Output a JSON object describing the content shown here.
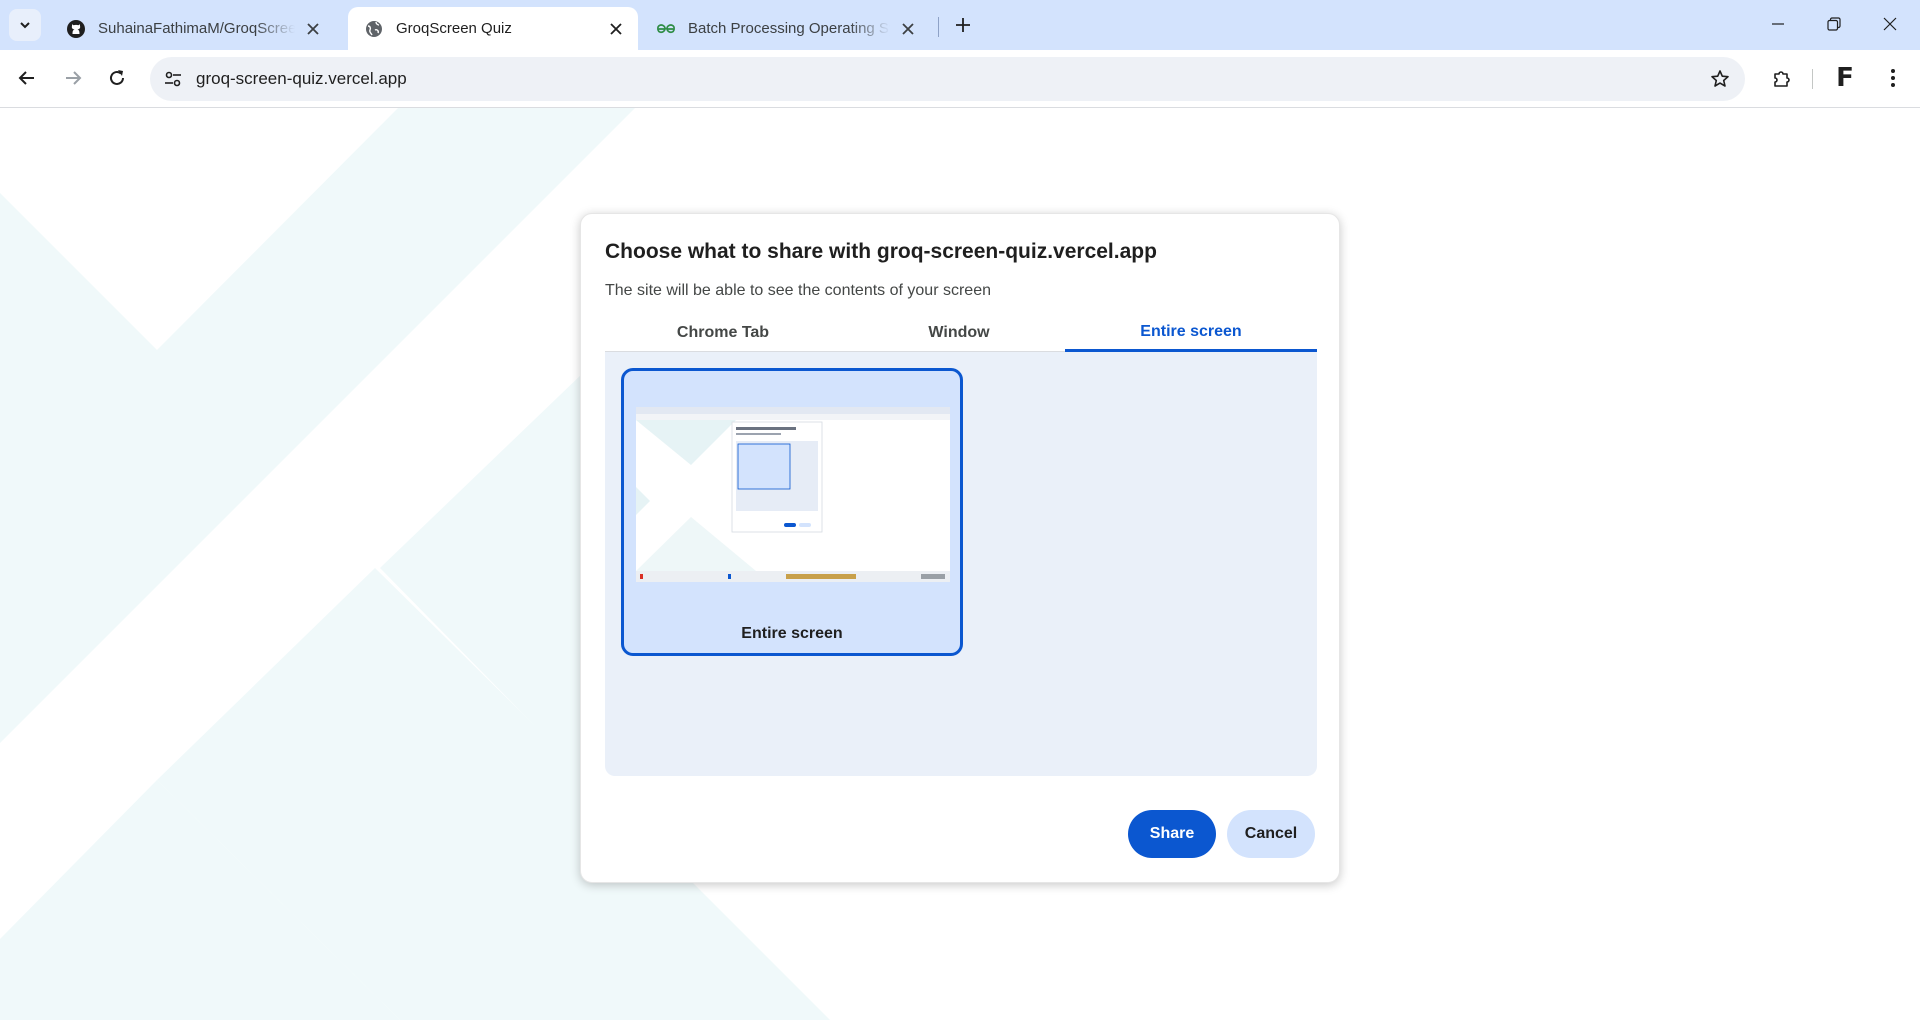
{
  "browser": {
    "tabs": [
      {
        "title": "SuhainaFathimaM/GroqScreen-Quiz",
        "favicon": "github-icon"
      },
      {
        "title": "GroqScreen Quiz",
        "favicon": "globe-icon"
      },
      {
        "title": "Batch Processing Operating System",
        "favicon": "geeksforgeeks-icon"
      }
    ],
    "url": "groq-screen-quiz.vercel.app",
    "profile_initial": "F"
  },
  "dialog": {
    "title": "Choose what to share with groq-screen-quiz.vercel.app",
    "subtitle": "The site will be able to see the contents of your screen",
    "tabs": [
      "Chrome Tab",
      "Window",
      "Entire screen"
    ],
    "active_tab": "Entire screen",
    "source_label": "Entire screen",
    "share_label": "Share",
    "cancel_label": "Cancel"
  },
  "colors": {
    "accent": "#0b57d0",
    "tabstrip": "#d3e3fd",
    "panel": "#eaf0f9"
  }
}
